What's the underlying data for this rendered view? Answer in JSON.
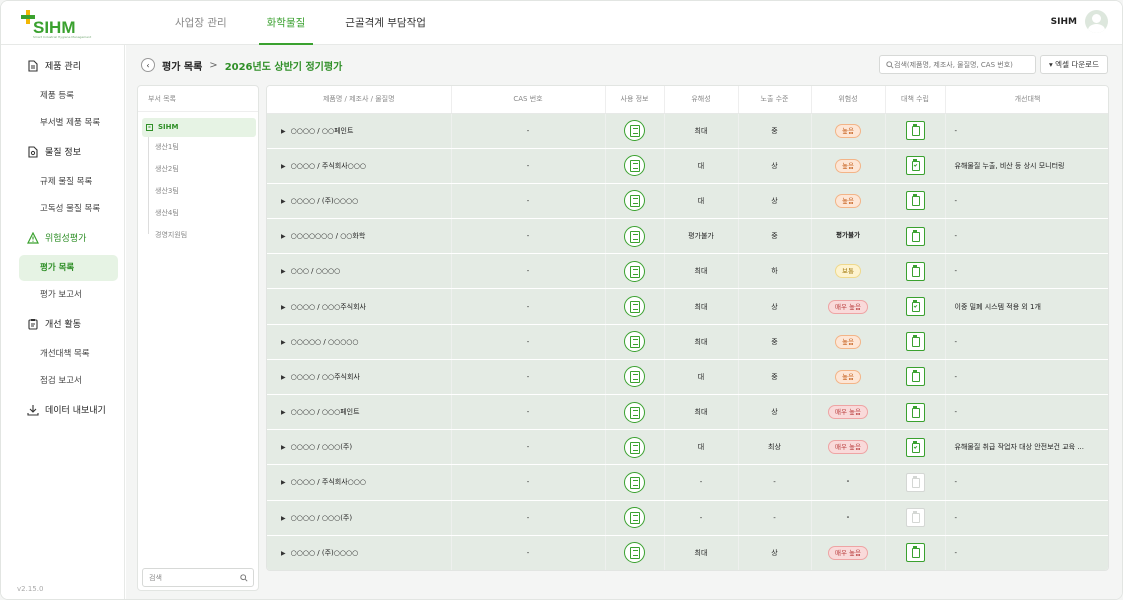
{
  "app": {
    "logo_text": "SIHM",
    "logo_sub": "Smart Industrial Hygiene Management",
    "version": "v2.15.0"
  },
  "topnav": {
    "tabs": [
      {
        "label": "사업장 관리"
      },
      {
        "label": "화학물질"
      },
      {
        "label": "근골격계 부담작업"
      }
    ]
  },
  "user": {
    "name": "SIHM"
  },
  "sidebar": {
    "groups": [
      {
        "label": "제품 관리",
        "icon": "document-icon"
      },
      {
        "label": "물질 정보",
        "icon": "flask-document-icon"
      },
      {
        "label": "위험성평가",
        "icon": "warning-triangle-icon"
      },
      {
        "label": "개선 활동",
        "icon": "clipboard-icon"
      },
      {
        "label": "데이터 내보내기",
        "icon": "download-icon"
      }
    ],
    "items": [
      {
        "label": "제품 등록"
      },
      {
        "label": "부서별 제품 목록"
      },
      {
        "label": "규제 물질 목록"
      },
      {
        "label": "고독성 물질 목록"
      },
      {
        "label": "평가 목록"
      },
      {
        "label": "평가 보고서"
      },
      {
        "label": "개선대책 목록"
      },
      {
        "label": "점검 보고서"
      }
    ]
  },
  "breadcrumb": {
    "parent": "평가 목록",
    "separator": ">",
    "current": "2026년도 상반기 정기평가"
  },
  "search": {
    "placeholder": "검색(제품명, 제조사, 물질명, CAS 번호)"
  },
  "excel_button": {
    "label": "▾ 엑셀 다운로드"
  },
  "tree": {
    "header": "부서 목록",
    "root": "SIHM",
    "children": [
      "생산1팀",
      "생산2팀",
      "생산3팀",
      "생산4팀",
      "경영지원팀"
    ],
    "search_placeholder": "검색"
  },
  "table": {
    "columns": [
      "제품명 / 제조사 / 물질명",
      "CAS 번호",
      "사용 정보",
      "유해성",
      "노출 수준",
      "위험성",
      "대책 수립",
      "개선대책"
    ],
    "rows": [
      {
        "product": "○○○○",
        "maker": "○○페인트",
        "cas": "-",
        "hazard": "최대",
        "exposure": "중",
        "risk": "높음",
        "risk_level": "high",
        "measure": "clip",
        "plan": "-"
      },
      {
        "product": "○○○○",
        "maker": "주식회사○○○",
        "cas": "-",
        "hazard": "대",
        "exposure": "상",
        "risk": "높음",
        "risk_level": "high",
        "measure": "check",
        "plan": "유해물질 누출, 비산 등 상시 모니터링"
      },
      {
        "product": "○○○○",
        "maker": "(주)○○○○",
        "cas": "-",
        "hazard": "대",
        "exposure": "상",
        "risk": "높음",
        "risk_level": "high",
        "measure": "clip",
        "plan": "-"
      },
      {
        "product": "○○○○○○○",
        "maker": "○○화학",
        "cas": "-",
        "hazard": "평가불가",
        "exposure": "중",
        "risk": "평가불가",
        "risk_level": "plain",
        "measure": "clip",
        "plan": "-"
      },
      {
        "product": "○○○",
        "maker": "○○○○",
        "cas": "-",
        "hazard": "최대",
        "exposure": "하",
        "risk": "보통",
        "risk_level": "mid",
        "measure": "clip",
        "plan": "-"
      },
      {
        "product": "○○○○",
        "maker": "○○○주식회사",
        "cas": "-",
        "hazard": "최대",
        "exposure": "상",
        "risk": "매우 높음",
        "risk_level": "vhigh",
        "measure": "check",
        "plan": "이중 밀폐 시스템 적용 외 1개"
      },
      {
        "product": "○○○○○",
        "maker": "○○○○○",
        "cas": "-",
        "hazard": "최대",
        "exposure": "중",
        "risk": "높음",
        "risk_level": "high",
        "measure": "clip",
        "plan": "-"
      },
      {
        "product": "○○○○",
        "maker": "○○주식회사",
        "cas": "-",
        "hazard": "대",
        "exposure": "중",
        "risk": "높음",
        "risk_level": "high",
        "measure": "clip",
        "plan": "-"
      },
      {
        "product": "○○○○",
        "maker": "○○○페인트",
        "cas": "-",
        "hazard": "최대",
        "exposure": "상",
        "risk": "매우 높음",
        "risk_level": "vhigh",
        "measure": "clip",
        "plan": "-"
      },
      {
        "product": "○○○○",
        "maker": "○○○(주)",
        "cas": "-",
        "hazard": "대",
        "exposure": "최상",
        "risk": "매우 높음",
        "risk_level": "vhigh",
        "measure": "check",
        "plan": "유해물질 취급 작업자 대상 안전보건 교육 ..."
      },
      {
        "product": "○○○○",
        "maker": "주식회사○○○",
        "cas": "-",
        "hazard": "-",
        "exposure": "-",
        "risk": "-",
        "risk_level": "plain",
        "measure": "disabled",
        "plan": "-"
      },
      {
        "product": "○○○○",
        "maker": "○○○(주)",
        "cas": "-",
        "hazard": "-",
        "exposure": "-",
        "risk": "-",
        "risk_level": "plain",
        "measure": "disabled",
        "plan": "-"
      },
      {
        "product": "○○○○",
        "maker": "(주)○○○○",
        "cas": "-",
        "hazard": "최대",
        "exposure": "상",
        "risk": "매우 높음",
        "risk_level": "vhigh",
        "measure": "clip",
        "plan": "-"
      }
    ]
  }
}
